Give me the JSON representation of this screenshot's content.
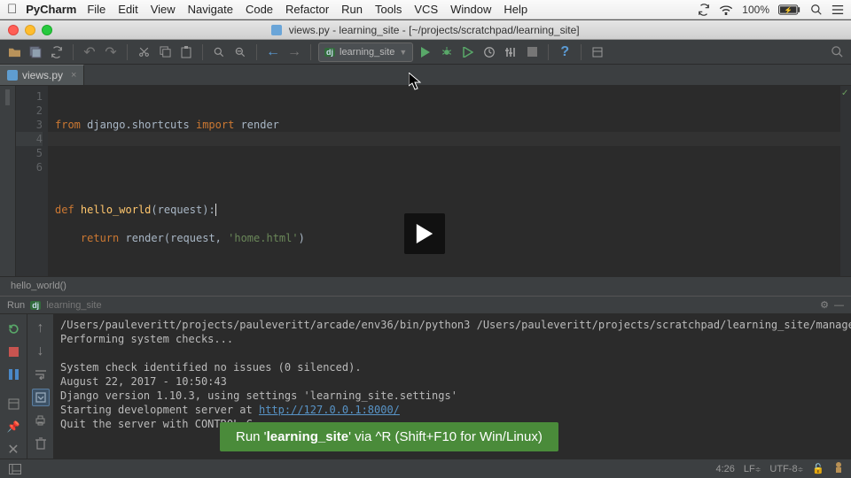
{
  "mac_menu": {
    "app": "PyCharm",
    "items": [
      "File",
      "Edit",
      "View",
      "Navigate",
      "Code",
      "Refactor",
      "Run",
      "Tools",
      "VCS",
      "Window",
      "Help"
    ],
    "battery": "100%"
  },
  "window": {
    "title_file": "views.py",
    "title_project": "learning_site",
    "title_path": "[~/projects/scratchpad/learning_site]"
  },
  "run_config": {
    "label": "learning_site"
  },
  "tabs": {
    "active": "views.py"
  },
  "gutter_lines": [
    "1",
    "2",
    "3",
    "4",
    "5",
    "6"
  ],
  "code_tokens": {
    "from": "from",
    "module": "django.shortcuts",
    "import": "import",
    "render": "render",
    "def": "def",
    "fn": "hello_world",
    "req": "request",
    "return": "return",
    "render2": "render",
    "arg1": "request",
    "arg2": "'home.html'"
  },
  "breadcrumb": "hello_world()",
  "tool_window": {
    "tab_label": "Run",
    "config": "learning_site",
    "console_lines": [
      "/Users/pauleveritt/projects/pauleveritt/arcade/env36/bin/python3 /Users/pauleveritt/projects/scratchpad/learning_site/manage.py",
      "Performing system checks...",
      "",
      "System check identified no issues (0 silenced).",
      "August 22, 2017 - 10:50:43",
      "Django version 1.10.3, using settings 'learning_site.settings'",
      "Starting development server at ",
      "Quit the server with CONTROL-C."
    ],
    "server_url": "http://127.0.0.1:8000/"
  },
  "statusbar": {
    "pos": "4:26",
    "le": "LF",
    "enc": "UTF-8"
  },
  "hint": {
    "pre": "Run '",
    "name": "learning_site",
    "mid": "' via ^R (Shift+F10 for Win/Linux)"
  }
}
